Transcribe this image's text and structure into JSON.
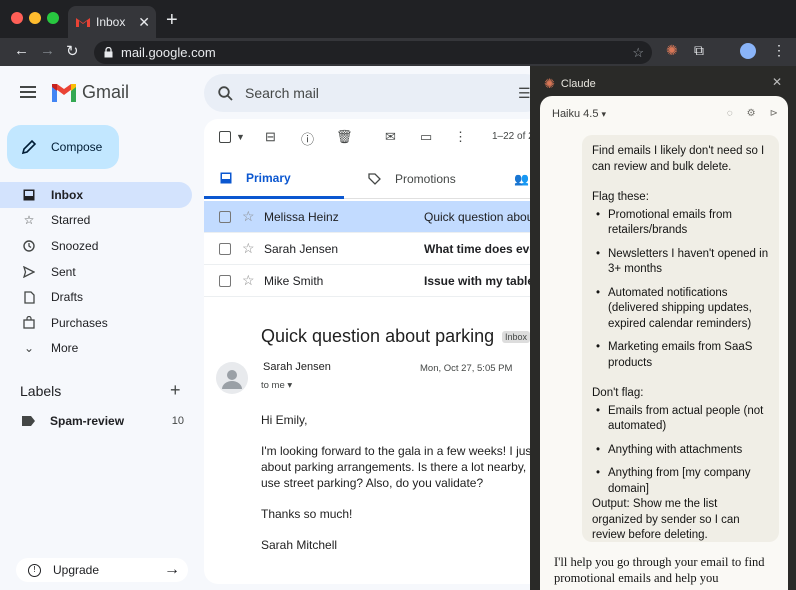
{
  "browser": {
    "tab_title": "Inbox",
    "url": "mail.google.com",
    "colors": {
      "close": "#ff5f57",
      "min": "#febc2e",
      "max": "#28c840"
    }
  },
  "gmail": {
    "logo_text": "Gmail",
    "search_placeholder": "Search mail",
    "compose_label": "Compose",
    "nav": [
      {
        "label": "Inbox",
        "icon": "inbox-icon"
      },
      {
        "label": "Starred",
        "icon": "star-icon"
      },
      {
        "label": "Snoozed",
        "icon": "clock-icon"
      },
      {
        "label": "Sent",
        "icon": "send-icon"
      },
      {
        "label": "Drafts",
        "icon": "draft-icon"
      },
      {
        "label": "Purchases",
        "icon": "bag-icon"
      },
      {
        "label": "More",
        "icon": "chevron-down-icon"
      }
    ],
    "labels_heading": "Labels",
    "labels": [
      {
        "name": "Spam-review",
        "count": "10"
      }
    ],
    "upgrade_label": "Upgrade",
    "range_text": "1–22 of 2",
    "tabs": [
      {
        "label": "Primary"
      },
      {
        "label": "Promotions"
      }
    ],
    "emails": [
      {
        "from": "Melissa Heinz",
        "subject": "Quick question about"
      },
      {
        "from": "Sarah Jensen",
        "subject": "What time does eve"
      },
      {
        "from": "Mike Smith",
        "subject": "Issue with my table"
      }
    ],
    "open_email": {
      "subject": "Quick question about parking",
      "tag": "Inbox",
      "sender": "Sarah Jensen",
      "date": "Mon, Oct 27, 5:05 PM",
      "to": "to me",
      "greeting": "Hi Emily,",
      "line1": "I'm looking forward to the gala in a few weeks! I just",
      "line2": "about parking arrangements. Is there a lot nearby, o",
      "line3": "use street parking? Also, do you validate?",
      "thanks": "Thanks so much!",
      "signature": "Sarah Mitchell"
    }
  },
  "claude": {
    "header_title": "Claude",
    "model": "Haiku 4.5",
    "prompt_intro": "Find emails I likely don't need so I can review and bulk delete.",
    "flag_heading": "Flag these:",
    "flag_items": [
      "Promotional emails from retailers/brands",
      "Newsletters I haven't opened in 3+ months",
      "Automated notifications (delivered shipping updates, expired calendar reminders)",
      "Marketing emails from SaaS products"
    ],
    "dont_flag_heading": "Don't flag:",
    "dont_flag_items": [
      "Emails from actual people (not automated)",
      "Anything with attachments",
      "Anything from [my company domain]"
    ],
    "output_text": "Output: Show me the list organized by sender so I can review before deleting.",
    "reply": "I'll help you go through your email to find promotional emails and help you"
  }
}
